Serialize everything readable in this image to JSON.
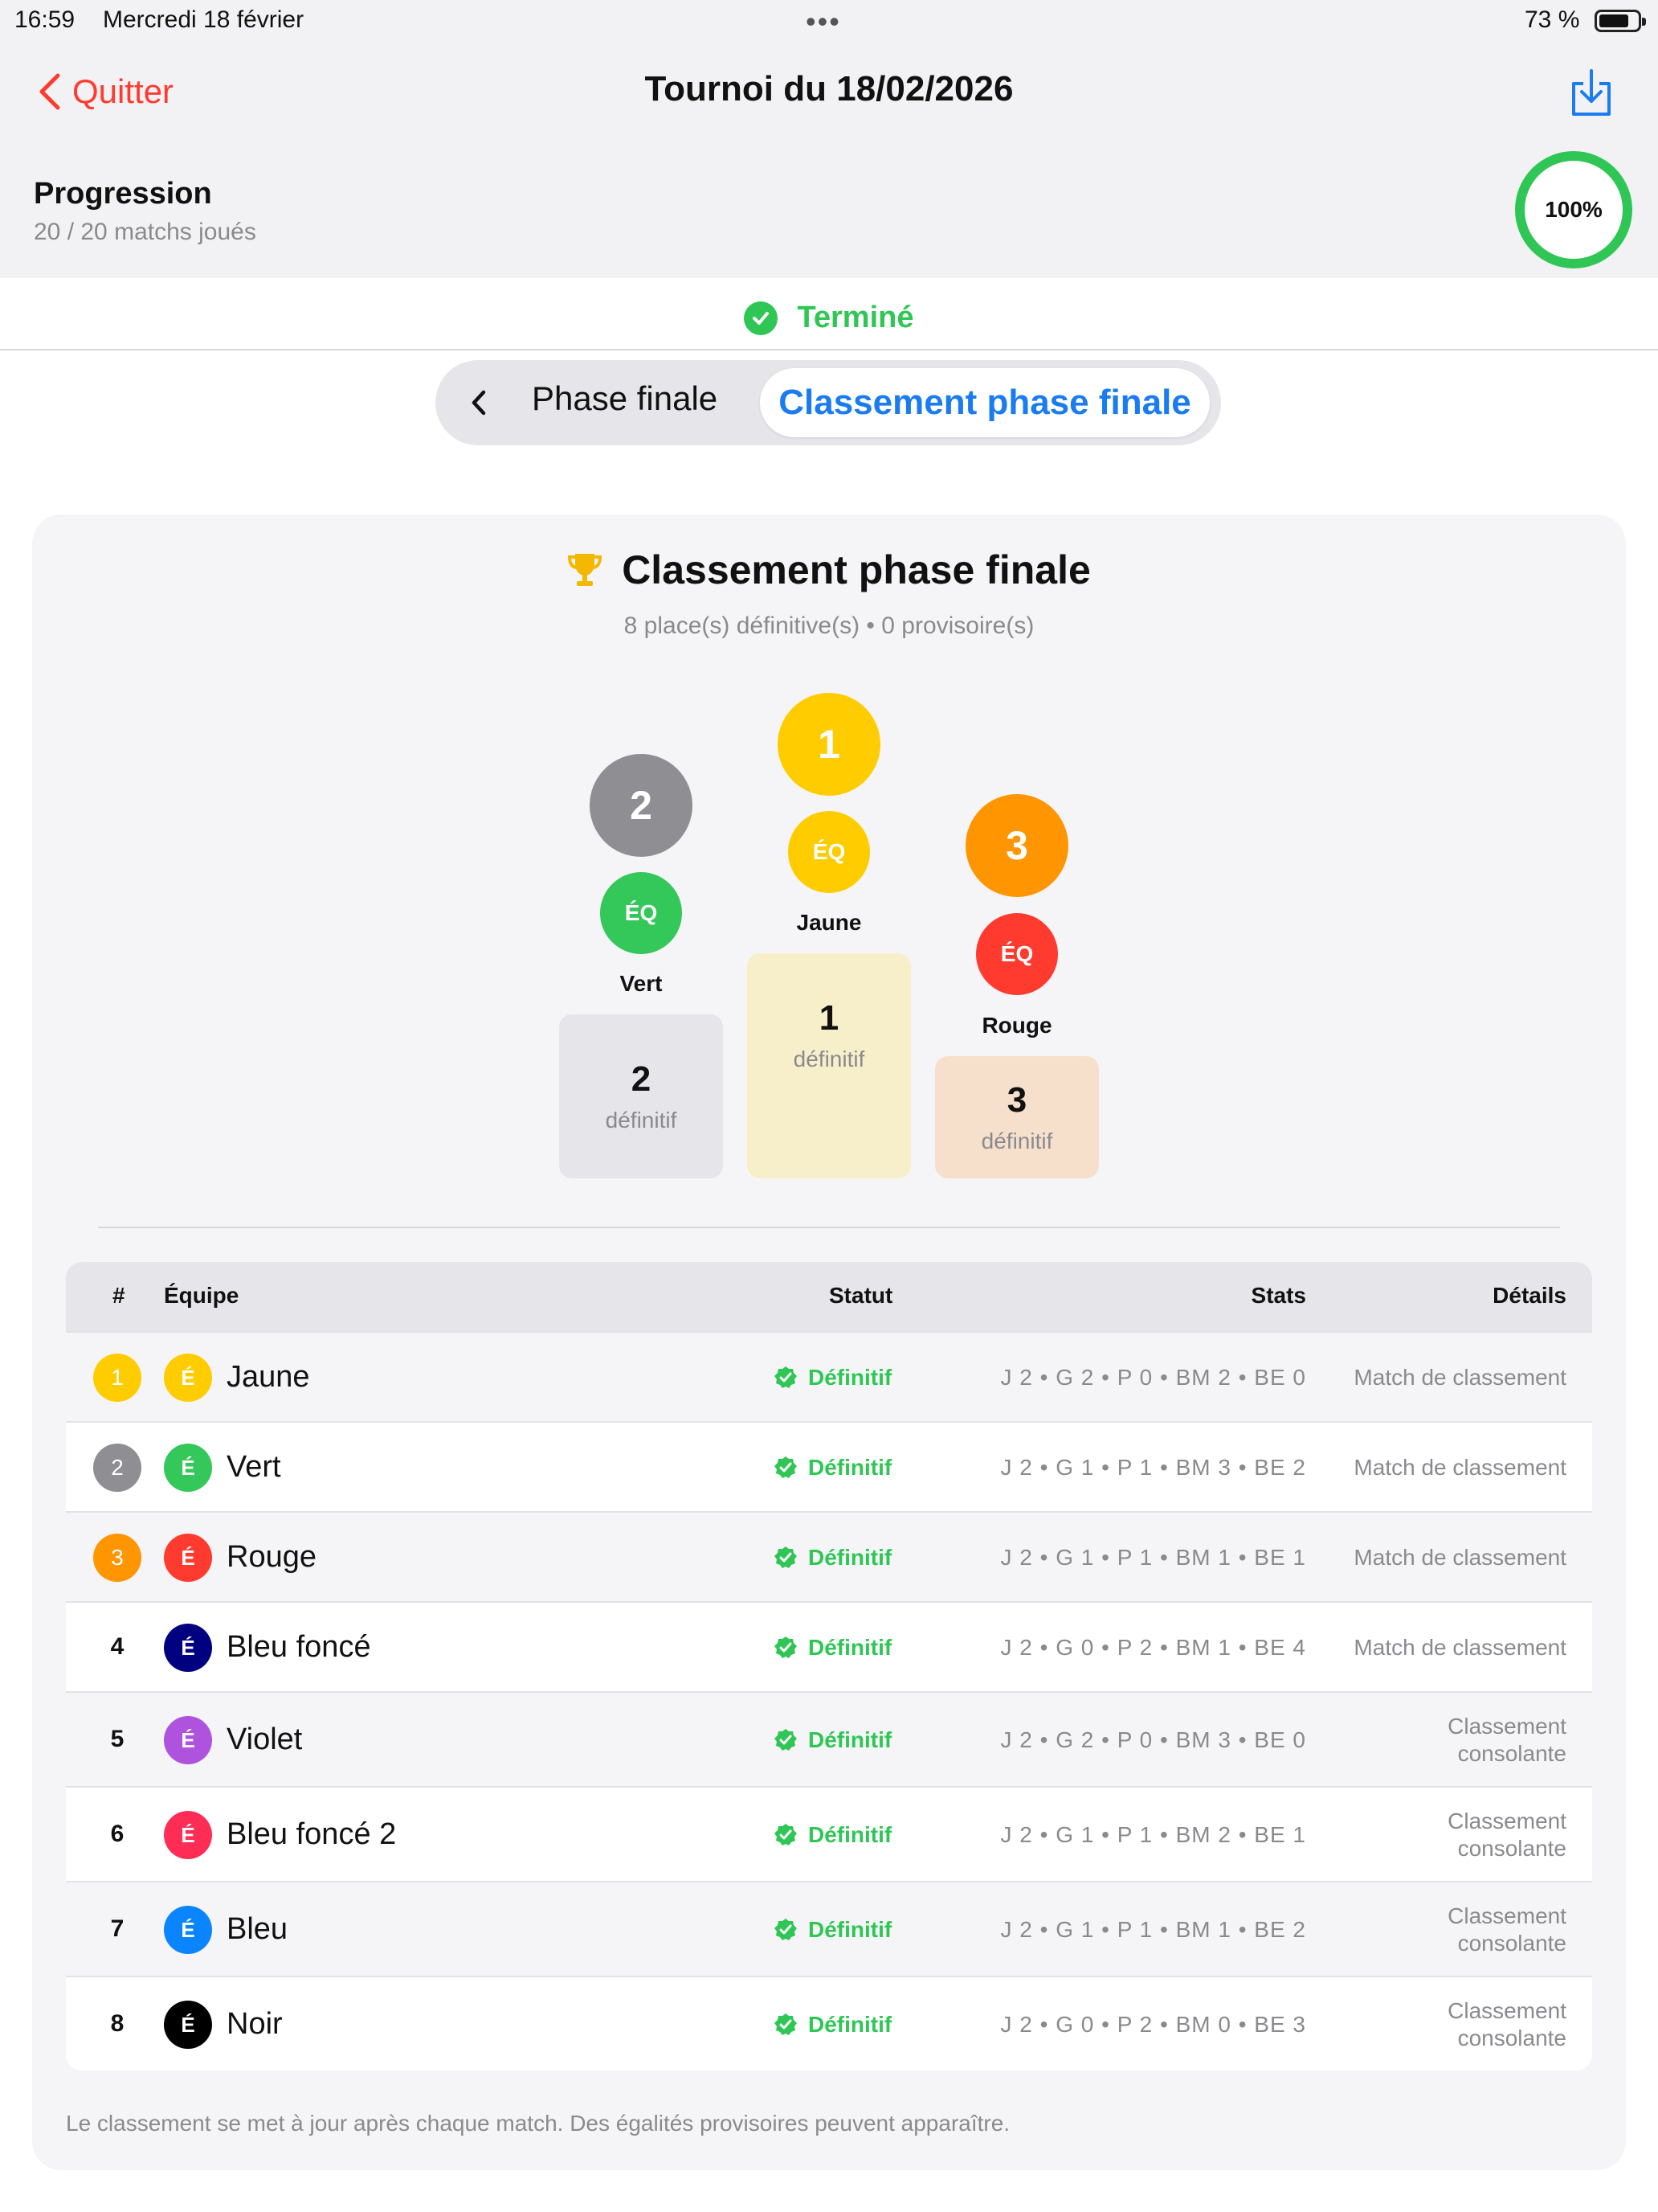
{
  "status_bar": {
    "time": "16:59",
    "date": "Mercredi 18 février",
    "battery": "73 %"
  },
  "nav": {
    "back_label": "Quitter",
    "title": "Tournoi du 18/02/2026"
  },
  "progress": {
    "title": "Progression",
    "subtitle": "20 / 20 matchs joués",
    "percent_label": "100%",
    "percent": 1.0
  },
  "status": {
    "label": "Terminé"
  },
  "segmented": {
    "option1": "Phase finale",
    "option2": "Classement phase finale",
    "selected": "option2"
  },
  "card": {
    "title": "Classement phase finale",
    "subtitle": "8 place(s) définitive(s) • 0 provisoire(s)"
  },
  "podium": {
    "first": {
      "rank": "1",
      "badge": "ÉQ",
      "name": "Jaune",
      "place": "1",
      "label": "définitif",
      "color": "#ffcc00",
      "block_color": "#f7efc9"
    },
    "second": {
      "rank": "2",
      "badge": "ÉQ",
      "name": "Vert",
      "place": "2",
      "label": "définitif",
      "color": "#8e8e93",
      "team_color": "#34c759",
      "block_color": "#e5e5ea"
    },
    "third": {
      "rank": "3",
      "badge": "ÉQ",
      "name": "Rouge",
      "place": "3",
      "label": "définitif",
      "color": "#ff9500",
      "team_color": "#ff3b30",
      "block_color": "#f6e0cc"
    }
  },
  "table": {
    "headers": {
      "rank": "#",
      "team": "Équipe",
      "status": "Statut",
      "stats": "Stats",
      "details": "Détails"
    },
    "rows": [
      {
        "rank": "1",
        "badge": "É",
        "team": "Jaune",
        "status": "Définitif",
        "stats": "J 2 • G 2 • P 0 • BM 2 • BE 0",
        "details": "Match de classement",
        "rank_color": "#ffcc00",
        "team_color": "#ffcc00"
      },
      {
        "rank": "2",
        "badge": "É",
        "team": "Vert",
        "status": "Définitif",
        "stats": "J 2 • G 1 • P 1 • BM 3 • BE 2",
        "details": "Match de classement",
        "rank_color": "#8e8e93",
        "team_color": "#34c759"
      },
      {
        "rank": "3",
        "badge": "É",
        "team": "Rouge",
        "status": "Définitif",
        "stats": "J 2 • G 1 • P 1 • BM 1 • BE 1",
        "details": "Match de classement",
        "rank_color": "#ff9500",
        "team_color": "#ff3b30"
      },
      {
        "rank": "4",
        "badge": "É",
        "team": "Bleu foncé",
        "status": "Définitif",
        "stats": "J 2 • G 0 • P 2 • BM 1 • BE 4",
        "details": "Match de classement",
        "team_color": "#000080"
      },
      {
        "rank": "5",
        "badge": "É",
        "team": "Violet",
        "status": "Définitif",
        "stats": "J 2 • G 2 • P 0 • BM 3 • BE 0",
        "details": "Classement\nconsolante",
        "team_color": "#af52de"
      },
      {
        "rank": "6",
        "badge": "É",
        "team": "Bleu foncé 2",
        "status": "Définitif",
        "stats": "J 2 • G 1 • P 1 • BM 2 • BE 1",
        "details": "Classement\nconsolante",
        "team_color": "#ff2d55"
      },
      {
        "rank": "7",
        "badge": "É",
        "team": "Bleu",
        "status": "Définitif",
        "stats": "J 2 • G 1 • P 1 • BM 1 • BE 2",
        "details": "Classement\nconsolante",
        "team_color": "#0a84ff"
      },
      {
        "rank": "8",
        "badge": "É",
        "team": "Noir",
        "status": "Définitif",
        "stats": "J 2 • G 0 • P 2 • BM 0 • BE 3",
        "details": "Classement\nconsolante",
        "team_color": "#000000"
      }
    ]
  },
  "footnote": "Le classement se met à jour après chaque match. Des égalités provisoires peuvent apparaître.",
  "colors": {
    "accent_blue": "#1a7cf0",
    "success_green": "#2fc655",
    "destructive_red": "#ff3b30"
  }
}
